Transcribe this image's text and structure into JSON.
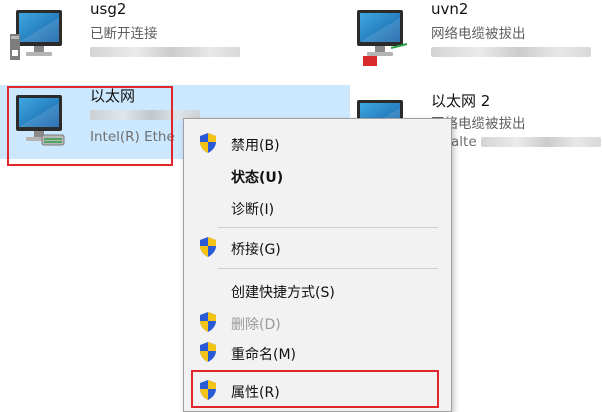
{
  "adapters": [
    {
      "id": "usg2",
      "name": "usg2",
      "status": "已断开连接",
      "device": ""
    },
    {
      "id": "uvn2",
      "name": "uvn2",
      "status": "网络电缆被拔出",
      "device": ""
    },
    {
      "id": "eth",
      "name": "以太网",
      "status": "",
      "device": "Intel(R) Ethe"
    },
    {
      "id": "eth2",
      "name": "以太网 2",
      "status": "网络电缆被拔出",
      "device": "alte"
    }
  ],
  "context_menu": {
    "items": [
      {
        "label": "禁用(B)",
        "icon": "uac-shield-icon",
        "style": "normal"
      },
      {
        "label": "状态(U)",
        "icon": "",
        "style": "bold"
      },
      {
        "label": "诊断(I)",
        "icon": "",
        "style": "normal"
      },
      {
        "label": "桥接(G)",
        "icon": "uac-shield-icon",
        "style": "normal"
      },
      {
        "label": "创建快捷方式(S)",
        "icon": "",
        "style": "normal"
      },
      {
        "label": "删除(D)",
        "icon": "uac-shield-icon",
        "style": "disabled"
      },
      {
        "label": "重命名(M)",
        "icon": "uac-shield-icon",
        "style": "normal"
      },
      {
        "label": "属性(R)",
        "icon": "uac-shield-icon",
        "style": "normal"
      }
    ]
  },
  "colors": {
    "selection": "#cce8ff",
    "highlight_box": "#e0262b",
    "menu_bg": "#f2f2f2"
  }
}
